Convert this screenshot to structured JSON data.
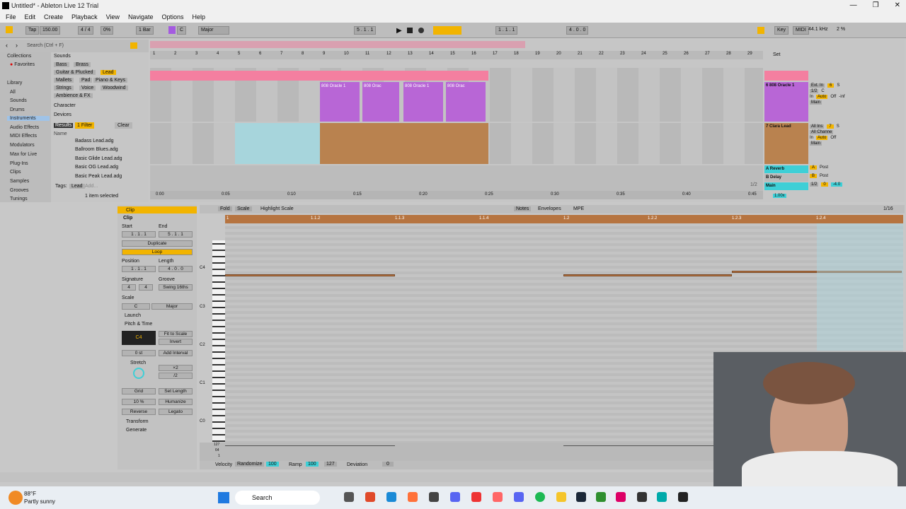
{
  "window": {
    "title": "Untitled* - Ableton Live 12 Trial"
  },
  "menu": [
    "File",
    "Edit",
    "Create",
    "Playback",
    "View",
    "Navigate",
    "Options",
    "Help"
  ],
  "control": {
    "tap": "Tap",
    "tempo": "150.00",
    "sig": "4 / 4",
    "pct": "0%",
    "quant": "1 Bar",
    "key": "C",
    "scale": "Major",
    "pos": "5 . 1 . 1",
    "loop_start": "1 . 1 . 1",
    "loop_len": "4 . 0 . 0",
    "key_btn": "Key",
    "midi_btn": "MIDI",
    "rate": "44.1 kHz",
    "cpu": "2 %"
  },
  "browser": {
    "search": "Search (Ctrl + F)",
    "collections": "Collections",
    "favorites": "Favorites",
    "library": "Library",
    "places": [
      "All",
      "Sounds",
      "Drums",
      "Instruments",
      "Audio Effects",
      "MIDI Effects",
      "Modulators",
      "Max for Live",
      "Plug-Ins",
      "Clips",
      "Samples",
      "Grooves",
      "Tunings"
    ],
    "sounds": "Sounds",
    "bass": "Bass",
    "brass": "Brass",
    "guitar": "Guitar & Plucked",
    "lead": "Lead",
    "mallets": "Mallets",
    "pad": "Pad",
    "piano": "Piano & Keys",
    "strings": "Strings",
    "voice": "Voice",
    "woodwind": "Woodwind",
    "ambience": "Ambience & FX",
    "character": "Character",
    "devices": "Devices",
    "results": "Results",
    "filter": "1 Filter",
    "clear": "Clear",
    "name": "Name",
    "files": [
      "Badass Lead.adg",
      "Ballroom Blues.adg",
      "Basic Glide Lead.adg",
      "Basic OG Lead.adg",
      "Basic Peak Lead.adg"
    ],
    "tags": "Tags:",
    "tag_lead": "Lead",
    "add": "Add...",
    "selected": "1 item selected"
  },
  "arrangement": {
    "bars": [
      "1",
      "2",
      "3",
      "4",
      "5",
      "6",
      "7",
      "8",
      "9",
      "10",
      "11",
      "12",
      "13",
      "14",
      "15",
      "16",
      "17",
      "18",
      "19",
      "20",
      "21",
      "22",
      "23",
      "24",
      "25",
      "26",
      "27",
      "28",
      "29"
    ],
    "times": [
      "0:00",
      "0:05",
      "0:10",
      "0:15",
      "0:20",
      "0:25",
      "0:30",
      "0:35",
      "0:40",
      "0:45"
    ],
    "clip_names": [
      "808 Oracle 1",
      "808 Orac",
      "808",
      "808 Oracle 1",
      "808 Orac",
      "808"
    ],
    "set": "Set",
    "page": "1/2",
    "tracks": [
      {
        "name": "6 808 Oracle 1",
        "num": "6",
        "in": "Ext. In",
        "ch": "1/2",
        "io": "In",
        "auto": "Auto",
        "off": "Off",
        "out": "Main",
        "s": "S",
        "c": "C",
        "inf": "-inf"
      },
      {
        "name": "7 Clara Lead",
        "num": "7",
        "in": "All Ins",
        "ch": "All Channe",
        "io": "In",
        "auto": "Auto",
        "off": "Off",
        "out": "Main",
        "s": "S"
      },
      {
        "name": "A Reverb",
        "num": "A",
        "post": "Post"
      },
      {
        "name": "B Delay",
        "num": "B",
        "post": "Post"
      },
      {
        "name": "Main",
        "ch": "1/2",
        "val": "0",
        "vol": "-4.0"
      }
    ],
    "zoom": "1.00x"
  },
  "clipview": {
    "clip": "Clip",
    "clip2": "Clip",
    "start": "Start",
    "end": "End",
    "set": "Set",
    "s_val": "1 . 1 . 1",
    "e_val": "5 . 1 . 1",
    "duplicate": "Duplicate",
    "loop": "Loop",
    "position": "Position",
    "length": "Length",
    "p_val": "1 . 1 . 1",
    "l_val": "4 . 0 . 0",
    "signature": "Signature",
    "groove": "Groove",
    "sig_n": "4",
    "sig_d": "4",
    "swing": "Swing 16ths",
    "scale": "Scale",
    "scale_key": "C",
    "scale_mode": "Major",
    "launch": "Launch",
    "pitch": "Pitch & Time",
    "note": "C4",
    "fit": "Fit to Scale",
    "invert": "Invert",
    "st": "0 st",
    "add_interval": "Add Interval",
    "stretch": "Stretch",
    "x2": "×2",
    "d2": "/2",
    "grid": "Grid",
    "set_length": "Set Length",
    "pct": "10 %",
    "humanize": "Humanize",
    "reverse": "Reverse",
    "legato": "Legato",
    "transform": "Transform",
    "generate": "Generate"
  },
  "editor": {
    "fold": "Fold",
    "scale": "Scale",
    "highlight": "Highlight Scale",
    "notes": "Notes",
    "envelopes": "Envelopes",
    "mpe": "MPE",
    "grid": "1/16",
    "ruler": [
      "1",
      "1.1.2",
      "1.1.3",
      "1.1.4",
      "1.2",
      "1.2.2",
      "1.2.3",
      "1.2.4"
    ],
    "octaves": [
      "C4",
      "C3",
      "C2",
      "C1",
      "C0"
    ],
    "vel_scale": [
      "127",
      "64",
      "1"
    ],
    "velocity": "Velocity",
    "randomize": "Randomize",
    "vel_val": "100",
    "ramp": "Ramp",
    "ramp_val": "100",
    "ramp_end": "127",
    "deviation": "Deviation",
    "dev_val": "0"
  },
  "taskbar": {
    "temp": "88°F",
    "weather": "Partly sunny",
    "search": "Search"
  }
}
